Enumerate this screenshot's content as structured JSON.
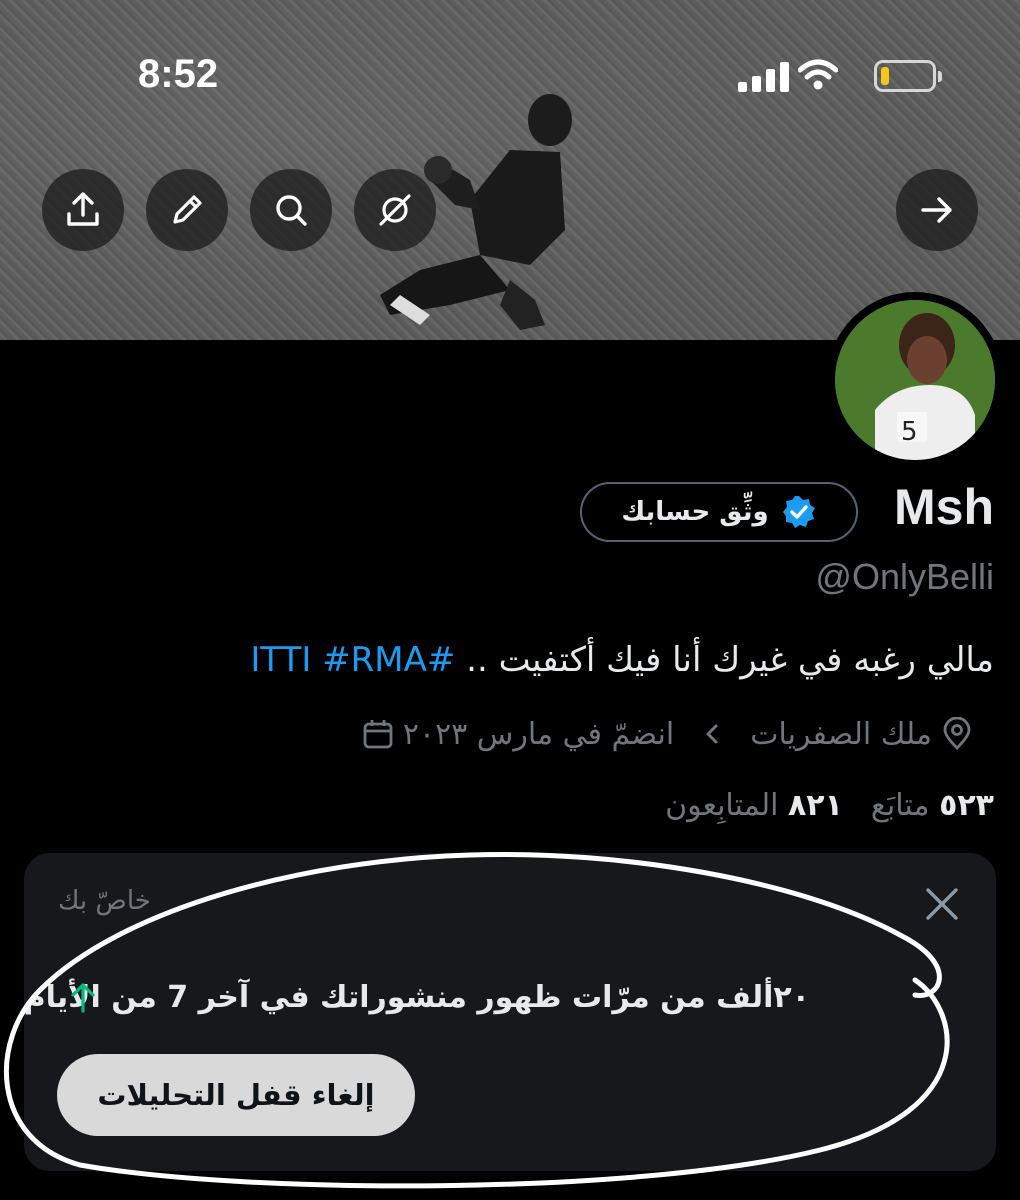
{
  "status_bar": {
    "time": "8:52"
  },
  "header_actions": {
    "back_icon": "arrow-right-icon",
    "icons": [
      "upload-icon",
      "pencil-icon",
      "search-icon",
      "grok-icon"
    ]
  },
  "profile": {
    "name": "Msh",
    "verify_label": "وثِّق حسابك",
    "handle": "@OnlyBelli",
    "bio_text": "مالي رغبه في غيرك أنا فيك أكتفيت .. ",
    "bio_hashtags": "#ITTI #RMA",
    "location": "ملك الصفريات",
    "joined": "انضمّ في مارس ٢٠٢٣",
    "following_count": "٥٢٣",
    "following_label": "متابَع",
    "followers_count": "٨٢١",
    "followers_label": "المتابِعون"
  },
  "analytics_card": {
    "private_label": "خاصّ بك",
    "impressions_text": "٢٠ألف من مرّات ظهور منشوراتك في آخر 7 من الأيام",
    "unlock_button": "إلغاء قفل التحليلات"
  },
  "colors": {
    "accent": "#1d9bf0",
    "trend_up": "#00ba7c",
    "background": "#000000",
    "card": "#16181c"
  }
}
